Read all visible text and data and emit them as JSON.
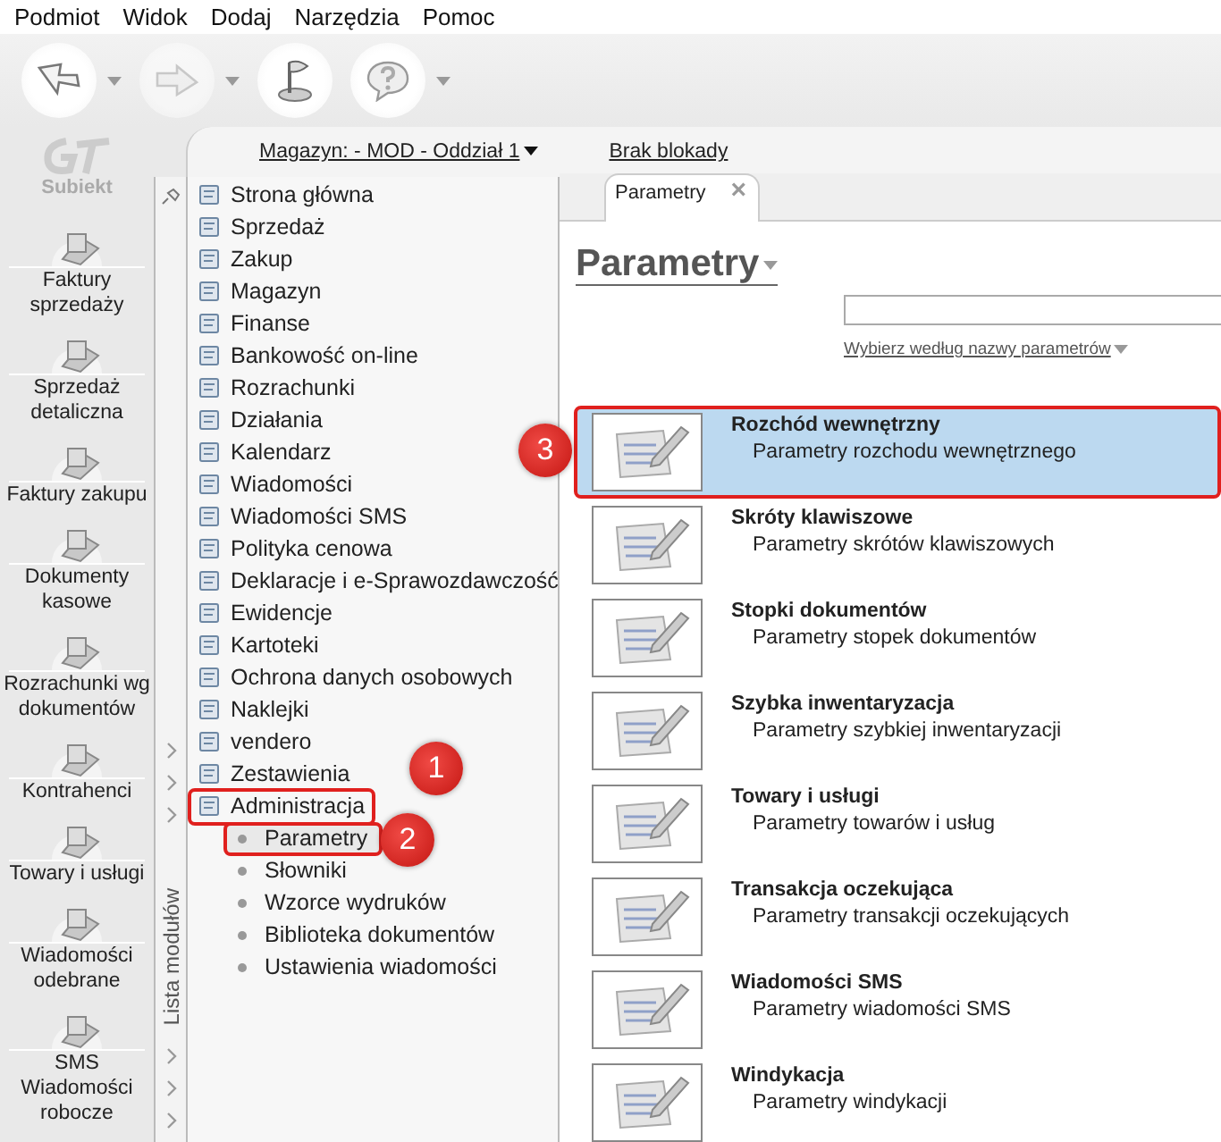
{
  "menu": [
    "Podmiot",
    "Widok",
    "Dodaj",
    "Narzędzia",
    "Pomoc"
  ],
  "toolbar": [
    {
      "kind": "back",
      "dropdown": true,
      "disabled": false
    },
    {
      "kind": "forward",
      "dropdown": true,
      "disabled": true
    },
    {
      "kind": "flag",
      "dropdown": false,
      "disabled": false
    },
    {
      "kind": "help",
      "dropdown": true,
      "disabled": false
    }
  ],
  "logo": {
    "text": "Subiekt"
  },
  "shortcuts": [
    "Faktury sprzedaży",
    "Sprzedaż detaliczna",
    "Faktury zakupu",
    "Dokumenty kasowe",
    "Rozrachunki wg dokumentów",
    "Kontrahenci",
    "Towary i usługi",
    "Wiadomości odebrane",
    "SMS Wiadomości robocze"
  ],
  "header": {
    "warehouse": "Magazyn: - MOD - Oddział 1",
    "lock": "Brak blokady"
  },
  "modules_panel": {
    "title": "Lista modułów",
    "items": [
      {
        "label": "Strona główna"
      },
      {
        "label": "Sprzedaż"
      },
      {
        "label": "Zakup"
      },
      {
        "label": "Magazyn"
      },
      {
        "label": "Finanse"
      },
      {
        "label": "Bankowość on-line"
      },
      {
        "label": "Rozrachunki"
      },
      {
        "label": "Działania"
      },
      {
        "label": "Kalendarz"
      },
      {
        "label": "Wiadomości"
      },
      {
        "label": "Wiadomości SMS"
      },
      {
        "label": "Polityka cenowa"
      },
      {
        "label": "Deklaracje i e-Sprawozdawczość"
      },
      {
        "label": "Ewidencje"
      },
      {
        "label": "Kartoteki"
      },
      {
        "label": "Ochrona danych osobowych"
      },
      {
        "label": "Naklejki"
      },
      {
        "label": "vendero"
      },
      {
        "label": "Zestawienia"
      },
      {
        "label": "Administracja",
        "highlighted": true,
        "marker": "1",
        "children": [
          {
            "label": "Parametry",
            "selected": true,
            "highlighted": true,
            "marker": "2"
          },
          {
            "label": "Słowniki",
            "selected": false
          },
          {
            "label": "Wzorce wydruków",
            "selected": false
          },
          {
            "label": "Biblioteka dokumentów",
            "selected": false
          },
          {
            "label": "Ustawienia wiadomości",
            "selected": false
          }
        ]
      }
    ]
  },
  "tab": {
    "label": "Parametry",
    "close": "×"
  },
  "heading": "Parametry",
  "filter_link": "Wybierz według nazwy parametrów",
  "parameters": [
    {
      "title": "Rozchód wewnętrzny",
      "subtitle": "Parametry rozchodu wewnętrznego",
      "selected": true,
      "highlighted": true,
      "marker": "3"
    },
    {
      "title": "Skróty klawiszowe",
      "subtitle": "Parametry skrótów klawiszowych",
      "selected": false
    },
    {
      "title": "Stopki dokumentów",
      "subtitle": "Parametry stopek dokumentów",
      "selected": false
    },
    {
      "title": "Szybka inwentaryzacja",
      "subtitle": "Parametry szybkiej inwentaryzacji",
      "selected": false
    },
    {
      "title": "Towary i usługi",
      "subtitle": "Parametry towarów i usług",
      "selected": false
    },
    {
      "title": "Transakcja oczekująca",
      "subtitle": "Parametry transakcji oczekujących",
      "selected": false
    },
    {
      "title": "Wiadomości SMS",
      "subtitle": "Parametry wiadomości SMS",
      "selected": false
    },
    {
      "title": "Windykacja",
      "subtitle": "Parametry windykacji",
      "selected": false
    }
  ]
}
